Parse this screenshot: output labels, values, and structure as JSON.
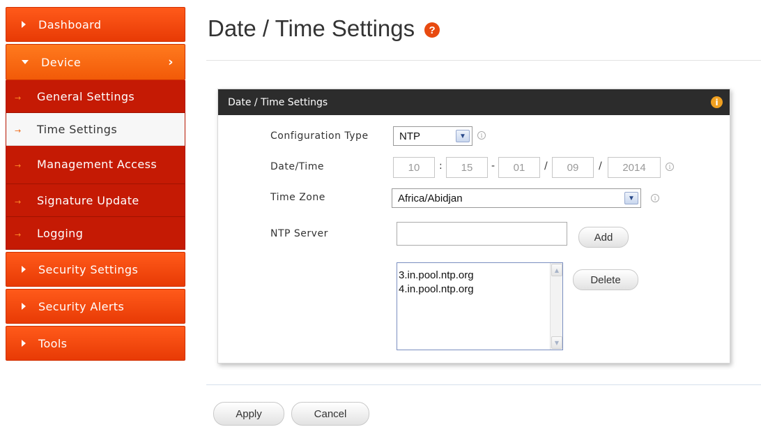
{
  "sidebar": {
    "dashboard": "Dashboard",
    "device": "Device",
    "device_chevron": "›",
    "sub_items": [
      {
        "label": "General Settings"
      },
      {
        "label": "Time Settings"
      },
      {
        "label": "Management Access"
      },
      {
        "label": "Signature Update"
      },
      {
        "label": "Logging"
      }
    ],
    "bottom_items": [
      {
        "label": "Security Settings"
      },
      {
        "label": "Security Alerts"
      },
      {
        "label": "Tools"
      }
    ],
    "arrow_glyph": "→"
  },
  "page": {
    "title": "Date / Time Settings",
    "help_glyph": "?"
  },
  "panel": {
    "title": "Date / Time Settings",
    "info_glyph": "i",
    "config_type": {
      "label": "Configuration Type",
      "value": "NTP"
    },
    "datetime": {
      "label": "Date/Time",
      "hour": "10",
      "minute": "15",
      "day": "01",
      "month": "09",
      "year": "2014",
      "sep_time": ":",
      "sep_dash": "-",
      "sep_slash": "/"
    },
    "timezone": {
      "label": "Time Zone",
      "value": "Africa/Abidjan"
    },
    "ntp_server": {
      "label": "NTP Server",
      "value": "",
      "add_label": "Add",
      "delete_label": "Delete",
      "servers": [
        "3.in.pool.ntp.org",
        "4.in.pool.ntp.org"
      ]
    }
  },
  "actions": {
    "apply": "Apply",
    "cancel": "Cancel"
  },
  "colors": {
    "nav_orange": "#f24a0c",
    "nav_red": "#c51a04",
    "panel_header": "#2c2c2c",
    "help": "#e84a10",
    "info": "#f0a020"
  }
}
